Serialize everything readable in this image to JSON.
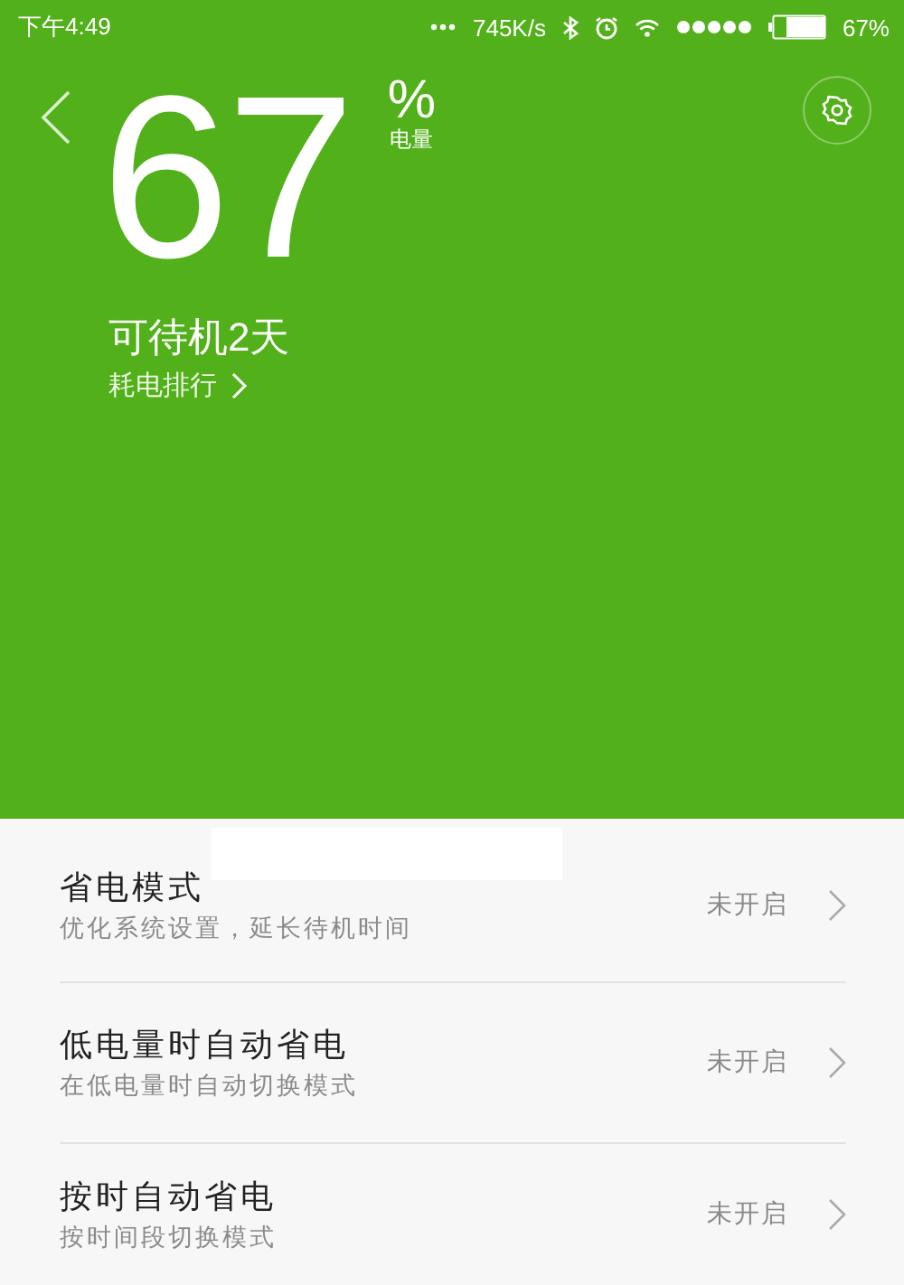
{
  "status_bar": {
    "time": "下午4:49",
    "net_speed": "745K/s",
    "battery_text": "67%"
  },
  "header": {
    "percent": "67",
    "unit": "%",
    "unit_label": "电量",
    "standby": "可待机2天",
    "ranking_link": "耗电排行"
  },
  "settings": [
    {
      "title": "省电模式",
      "subtitle": "优化系统设置，延长待机时间",
      "status": "未开启"
    },
    {
      "title": "低电量时自动省电",
      "subtitle": "在低电量时自动切换模式",
      "status": "未开启"
    },
    {
      "title": "按时自动省电",
      "subtitle": "按时间段切换模式",
      "status": "未开启"
    }
  ]
}
